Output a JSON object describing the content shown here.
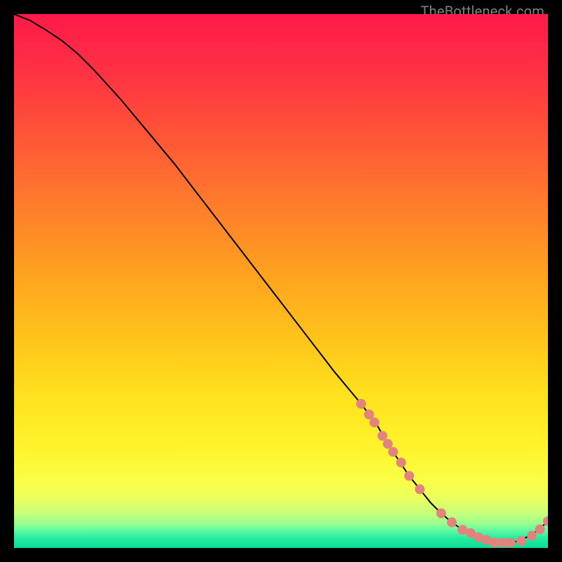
{
  "watermark": "TheBottleneck.com",
  "colors": {
    "curve": "#000000",
    "marker_fill": "#e2837d",
    "marker_stroke": "#d66d66"
  },
  "chart_data": {
    "type": "line",
    "title": "",
    "xlabel": "",
    "ylabel": "",
    "xlim": [
      0,
      100
    ],
    "ylim": [
      0,
      100
    ],
    "series": [
      {
        "name": "curve",
        "x": [
          0,
          3,
          6,
          9,
          12,
          15,
          20,
          25,
          30,
          35,
          40,
          45,
          50,
          55,
          60,
          65,
          68,
          70,
          72,
          74,
          76,
          78,
          80,
          82,
          84,
          86,
          88,
          90,
          92,
          94,
          96,
          98,
          100
        ],
        "y": [
          100,
          98.8,
          97.0,
          95.0,
          92.5,
          89.5,
          84.0,
          78.0,
          72.0,
          65.5,
          59.0,
          52.5,
          46.0,
          39.5,
          33.0,
          27.0,
          23.0,
          19.5,
          16.5,
          13.5,
          11.0,
          8.5,
          6.5,
          4.8,
          3.4,
          2.3,
          1.5,
          1.0,
          1.0,
          1.2,
          2.0,
          3.2,
          5.0
        ]
      },
      {
        "name": "markers",
        "x": [
          65.0,
          66.5,
          67.5,
          69.0,
          70.0,
          71.0,
          72.5,
          74.0,
          76.0,
          80.0,
          82.0,
          84.0,
          85.5,
          87.0,
          88.5,
          90.0,
          91.5,
          93.0,
          95.0,
          97.0,
          98.5,
          100.0
        ],
        "y": [
          27.0,
          25.0,
          23.5,
          21.0,
          19.5,
          18.0,
          16.0,
          13.5,
          11.0,
          6.5,
          4.8,
          3.4,
          2.8,
          2.0,
          1.5,
          1.0,
          1.0,
          1.0,
          1.3,
          2.3,
          3.5,
          5.0
        ]
      }
    ]
  }
}
